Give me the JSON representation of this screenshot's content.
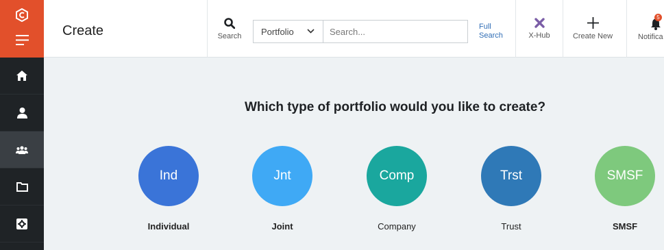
{
  "header": {
    "title": "Create",
    "search_label": "Search",
    "portfolio_select": "Portfolio",
    "search_placeholder": "Search...",
    "full_search_line1": "Full",
    "full_search_line2": "Search",
    "xhub_label": "X-Hub",
    "create_new_label": "Create New",
    "notifications_label": "Notifica",
    "notifications_badge": "5"
  },
  "sidebar": {
    "items": [
      {
        "icon": "home-icon"
      },
      {
        "icon": "user-icon"
      },
      {
        "icon": "group-icon",
        "active": true
      },
      {
        "icon": "folder-icon"
      },
      {
        "icon": "settings-icon"
      }
    ]
  },
  "main": {
    "question": "Which type of portfolio would you like to create?",
    "options": [
      {
        "abbr": "Ind",
        "label": "Individual",
        "color": "#3a74d8"
      },
      {
        "abbr": "Jnt",
        "label": "Joint",
        "color": "#3fa9f5"
      },
      {
        "abbr": "Comp",
        "label": "Company",
        "color": "#1aa79e"
      },
      {
        "abbr": "Trst",
        "label": "Trust",
        "color": "#2f79b7"
      },
      {
        "abbr": "SMSF",
        "label": "SMSF",
        "color": "#7ec97d"
      }
    ]
  },
  "colors": {
    "brand": "#e2502b",
    "sidebar": "#1f2326",
    "background": "#eef2f4",
    "xhub": "#7b5ea7",
    "link": "#2f6db5"
  }
}
